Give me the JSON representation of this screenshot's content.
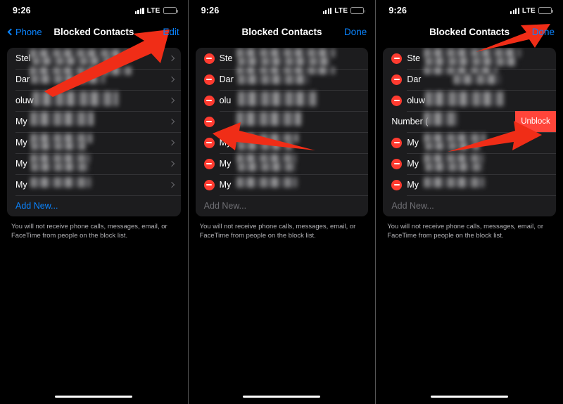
{
  "status_bar": {
    "time": "9:26",
    "network": "LTE",
    "battery_color": "#f5c518",
    "signal_icon": "signal-bars-icon"
  },
  "accent_blue": "#0a84ff",
  "destructive_red": "#ff3b30",
  "annotation_color": "#f02d17",
  "panels": [
    {
      "id": "panel-view-mode",
      "nav": {
        "back_label": "Phone",
        "title": "Blocked Contacts",
        "action_label": "Edit"
      },
      "edit_mode": false,
      "rows": [
        {
          "name": "Stel",
          "accessory": "chevron"
        },
        {
          "name": "Dar",
          "accessory": "chevron"
        },
        {
          "name": "oluw",
          "accessory": "chevron"
        },
        {
          "name": "My",
          "accessory": "chevron"
        },
        {
          "name": "My",
          "accessory": "chevron"
        },
        {
          "name": "My",
          "accessory": "chevron"
        },
        {
          "name": "My",
          "accessory": "chevron"
        }
      ],
      "add_new_label": "Add New...",
      "add_new_enabled": true,
      "footer": "You will not receive phone calls, messages, email, or FaceTime from people on the block list."
    },
    {
      "id": "panel-edit-mode",
      "nav": {
        "back_label": "",
        "title": "Blocked Contacts",
        "action_label": "Done"
      },
      "edit_mode": true,
      "rows": [
        {
          "name": "Ste",
          "accessory": "delete"
        },
        {
          "name": "Dar",
          "accessory": "delete"
        },
        {
          "name": "olu",
          "accessory": "delete"
        },
        {
          "name": "",
          "accessory": "delete"
        },
        {
          "name": "My",
          "accessory": "delete"
        },
        {
          "name": "My",
          "accessory": "delete"
        },
        {
          "name": "My",
          "accessory": "delete"
        }
      ],
      "add_new_label": "Add New...",
      "add_new_enabled": false,
      "footer": "You will not receive phone calls, messages, email, or FaceTime from people on the block list."
    },
    {
      "id": "panel-unblock-swipe",
      "nav": {
        "back_label": "",
        "title": "Blocked Contacts",
        "action_label": "Done"
      },
      "edit_mode": true,
      "rows": [
        {
          "name": "Ste",
          "accessory": "delete"
        },
        {
          "name": "Dar",
          "accessory": "delete"
        },
        {
          "name": "oluw",
          "accessory": "delete"
        },
        {
          "name": "Number (",
          "accessory": "swiped",
          "action_label": "Unblock"
        },
        {
          "name": "My",
          "accessory": "delete"
        },
        {
          "name": "My",
          "accessory": "delete"
        },
        {
          "name": "My",
          "accessory": "delete"
        }
      ],
      "add_new_label": "Add New...",
      "add_new_enabled": false,
      "footer": "You will not receive phone calls, messages, email, or FaceTime from people on the block list."
    }
  ]
}
